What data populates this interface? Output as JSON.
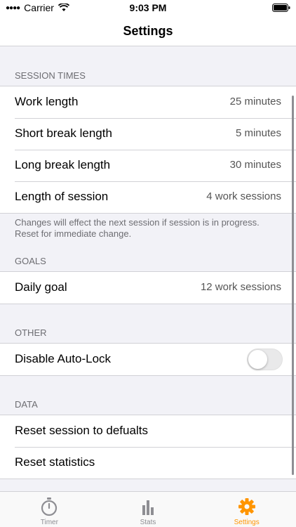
{
  "status_bar": {
    "carrier": "Carrier",
    "time": "9:03 PM"
  },
  "nav": {
    "title": "Settings"
  },
  "sections": {
    "session_times": {
      "header": "SESSION TIMES",
      "rows": [
        {
          "label": "Work length",
          "value": "25 minutes"
        },
        {
          "label": "Short break length",
          "value": "5 minutes"
        },
        {
          "label": "Long break length",
          "value": "30 minutes"
        },
        {
          "label": "Length of session",
          "value": "4 work sessions"
        }
      ],
      "footer": "Changes will effect the next session if session is in progress. Reset for immediate change."
    },
    "goals": {
      "header": "GOALS",
      "rows": [
        {
          "label": "Daily goal",
          "value": "12 work sessions"
        }
      ]
    },
    "other": {
      "header": "OTHER",
      "rows": [
        {
          "label": "Disable Auto-Lock",
          "toggle_on": false
        }
      ]
    },
    "data": {
      "header": "DATA",
      "rows": [
        {
          "label": "Reset session to defualts"
        },
        {
          "label": "Reset statistics"
        }
      ]
    }
  },
  "tabs": [
    {
      "label": "Timer",
      "icon": "stopwatch-icon",
      "active": false
    },
    {
      "label": "Stats",
      "icon": "bar-chart-icon",
      "active": false
    },
    {
      "label": "Settings",
      "icon": "gear-icon",
      "active": true
    }
  ],
  "colors": {
    "accent": "#ff9500",
    "background": "#f2f2f7",
    "separator": "#d1d1d6"
  }
}
